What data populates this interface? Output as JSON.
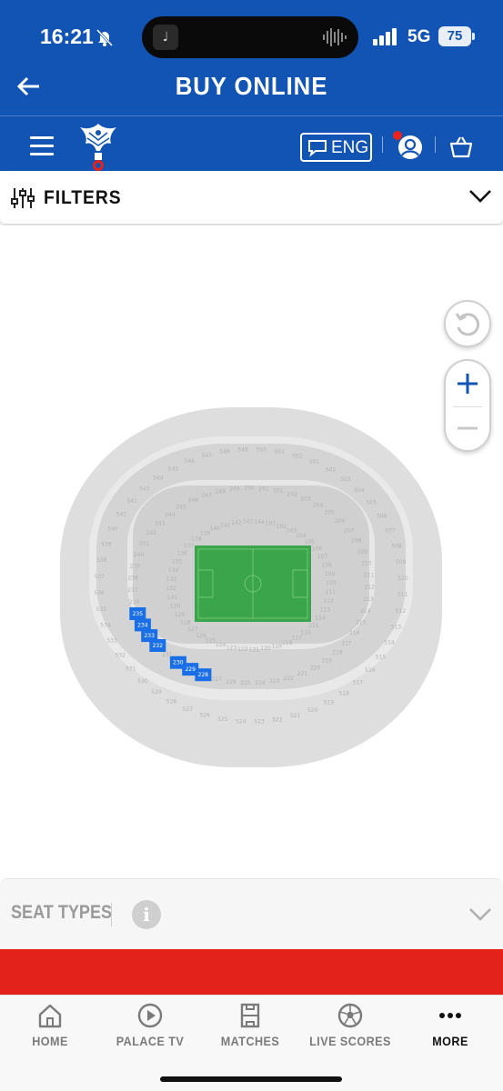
{
  "status_bar": {
    "time": "16:21",
    "network": "5G",
    "battery": "75"
  },
  "header": {
    "title": "BUY ONLINE",
    "back_icon": "arrow-left-icon"
  },
  "nav": {
    "language": "ENG",
    "menu_icon": "hamburger-icon",
    "account_icon": "account-icon",
    "basket_icon": "basket-icon"
  },
  "filters": {
    "label": "FILTERS"
  },
  "map_controls": {
    "reset": "reset-icon",
    "zoom_in": "+",
    "zoom_out": "−"
  },
  "stadium": {
    "outer_ring": [
      "548",
      "549",
      "550",
      "551",
      "552",
      "501",
      "502",
      "503",
      "504",
      "505",
      "506",
      "507",
      "508",
      "509",
      "510",
      "511",
      "512",
      "513",
      "514",
      "515",
      "516",
      "517",
      "518",
      "519",
      "520",
      "521",
      "522",
      "523",
      "524",
      "525",
      "526",
      "527",
      "528",
      "529",
      "530",
      "531",
      "532",
      "533",
      "534",
      "535",
      "536",
      "537",
      "538",
      "539",
      "540",
      "541",
      "542",
      "543",
      "544",
      "545",
      "546",
      "547"
    ],
    "middle_ring": [
      "248",
      "249",
      "250",
      "251",
      "201",
      "202",
      "203",
      "204",
      "205",
      "206",
      "207",
      "208",
      "209",
      "210",
      "211",
      "212",
      "213",
      "214",
      "215",
      "216",
      "217",
      "218",
      "219",
      "220",
      "221",
      "222",
      "223",
      "224",
      "225",
      "226",
      "227",
      "228",
      "229",
      "230",
      "231",
      "232",
      "233",
      "234",
      "235",
      "236",
      "237",
      "238",
      "239",
      "240",
      "241",
      "242",
      "243",
      "244",
      "245",
      "246",
      "247"
    ],
    "inner_ring": [
      "139",
      "140",
      "141",
      "142",
      "143",
      "144",
      "101",
      "102",
      "103",
      "104",
      "105",
      "106",
      "107",
      "108",
      "109",
      "110",
      "111",
      "112",
      "113",
      "114",
      "115",
      "116",
      "117",
      "118",
      "119",
      "120",
      "121",
      "122",
      "123",
      "124",
      "125",
      "126",
      "127",
      "128",
      "129",
      "130",
      "131",
      "132",
      "133",
      "134",
      "135",
      "136",
      "137",
      "138"
    ],
    "available_sections": [
      "235",
      "234",
      "233",
      "232",
      "230",
      "229",
      "228"
    ],
    "highlight_color": "#1a6fe6"
  },
  "seat_types": {
    "label": "SEAT TYPES",
    "info": "i"
  },
  "tabbar": [
    {
      "label": "HOME",
      "icon": "home-icon"
    },
    {
      "label": "PALACE TV",
      "icon": "play-icon"
    },
    {
      "label": "MATCHES",
      "icon": "matches-icon"
    },
    {
      "label": "LIVE SCORES",
      "icon": "football-icon"
    },
    {
      "label": "MORE",
      "icon": "more-icon"
    }
  ],
  "colors": {
    "brand_blue": "#1254b3",
    "banner_red": "#e2221b",
    "pitch_green": "#3aa54a"
  }
}
